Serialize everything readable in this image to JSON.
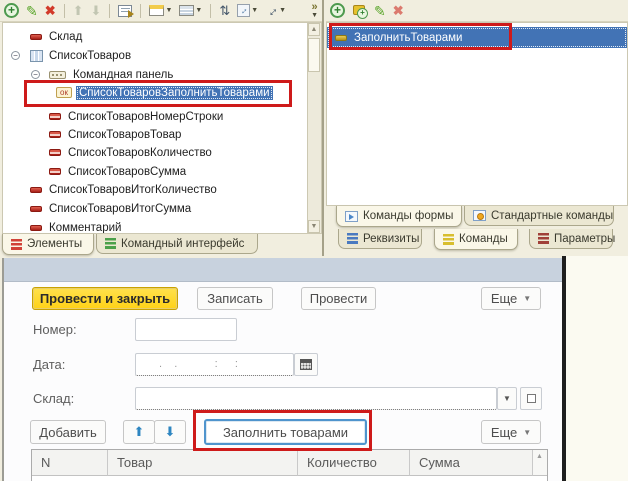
{
  "colors": {
    "annotation_red": "#CE1A1A",
    "selection_blue": "#4273B5",
    "primary_button_yellow": "#FFD216",
    "form_header_strip": "#C8D2DE",
    "designer_background": "#F1EEDF"
  },
  "left_panel": {
    "toolbar": [
      {
        "name": "add-button",
        "icon": "add-icon",
        "glyph": "+"
      },
      {
        "name": "edit-button",
        "icon": "pencil-icon",
        "glyph": "✎"
      },
      {
        "name": "delete-button",
        "icon": "delete-icon",
        "glyph": "✖"
      },
      {
        "sep": true
      },
      {
        "name": "move-up-button",
        "icon": "arrow-up-icon",
        "glyph": "⬆"
      },
      {
        "name": "move-down-button",
        "icon": "arrow-down-icon",
        "glyph": "⬇"
      },
      {
        "sep": true
      },
      {
        "name": "check-form-button",
        "icon": "form-check-icon"
      },
      {
        "sep": true
      },
      {
        "name": "form-view-button",
        "icon": "window-title-icon",
        "dropdown": true
      },
      {
        "name": "form-arrangement-button",
        "icon": "window-rows-icon",
        "dropdown": true
      },
      {
        "sep": true
      },
      {
        "name": "swap-elements-button",
        "icon": "swap-arrows-icon",
        "glyph": "⇅"
      },
      {
        "name": "resize-mode-button",
        "icon": "resize-box-icon",
        "glyph": "↔",
        "dropdown": true
      },
      {
        "name": "spacing-button",
        "icon": "diagonal-arrow-icon",
        "glyph": "↔",
        "dropdown": true
      }
    ],
    "overflow": {
      "name": "toolbar-overflow",
      "glyph": "»"
    },
    "tree": [
      {
        "label": "Склад",
        "depth": 0,
        "icon": "field-icon"
      },
      {
        "label": "СписокТоваров",
        "depth": 0,
        "icon": "table-icon",
        "expanded": true
      },
      {
        "label": "Командная панель",
        "depth": 1,
        "icon": "command-bar-icon",
        "expanded": true
      },
      {
        "label": "СписокТоваровЗаполнитьТоварами",
        "depth": 2,
        "icon": "ok-button-icon",
        "icon_text": "ок",
        "selected": true
      },
      {
        "label": "СписокТоваровНомерСтроки",
        "depth": 1,
        "icon": "column-icon"
      },
      {
        "label": "СписокТоваровТовар",
        "depth": 1,
        "icon": "column-icon"
      },
      {
        "label": "СписокТоваровКоличество",
        "depth": 1,
        "icon": "column-icon"
      },
      {
        "label": "СписокТоваровСумма",
        "depth": 1,
        "icon": "column-icon"
      },
      {
        "label": "СписокТоваровИтогКоличество",
        "depth": 0,
        "icon": "field-icon"
      },
      {
        "label": "СписокТоваровИтогСумма",
        "depth": 0,
        "icon": "field-icon"
      },
      {
        "label": "Комментарий",
        "depth": 0,
        "icon": "field-icon"
      }
    ],
    "tabs": [
      {
        "label": "Элементы",
        "icon_color": "#D14238",
        "active": true
      },
      {
        "label": "Командный интерфейс",
        "icon_color": "#4BA04B",
        "active": false
      }
    ]
  },
  "right_panel": {
    "toolbar": [
      {
        "name": "add-command-button",
        "icon": "add-icon",
        "glyph": "+"
      },
      {
        "name": "add-standard-command-button",
        "icon": "add-standard-icon"
      },
      {
        "name": "edit-command-button",
        "icon": "pencil-icon",
        "glyph": "✎"
      },
      {
        "name": "delete-command-button",
        "icon": "delete-icon",
        "glyph": "✖",
        "dim": true
      }
    ],
    "list": [
      {
        "label": "ЗаполнитьТоварами",
        "icon": "command-icon",
        "selected": true
      }
    ],
    "inner_tabs": [
      {
        "label": "Команды формы",
        "icon": "play",
        "active": true
      },
      {
        "label": "Стандартные команды",
        "icon": "dot",
        "active": false
      }
    ],
    "outer_tabs": [
      {
        "label": "Реквизиты",
        "icon_color": "#4A7AC0",
        "active": false
      },
      {
        "label": "Команды",
        "icon_color": "#D8BE2E",
        "active": true
      },
      {
        "label": "Параметры",
        "icon_color": "#A04038",
        "active": false
      }
    ]
  },
  "form_preview": {
    "commands": [
      {
        "label": "Провести и закрыть"
      },
      {
        "label": "Записать"
      },
      {
        "label": "Провести"
      },
      {
        "label": "Еще"
      }
    ],
    "fields": [
      {
        "label": "Номер:"
      },
      {
        "label": "Дата:",
        "placeholder": " .  .       :   :"
      },
      {
        "label": "Склад:"
      }
    ],
    "table_toolbar": {
      "add_label": "Добавить",
      "fill_label": "Заполнить товарами",
      "more_label": "Еще"
    },
    "table_headers": [
      "N",
      "Товар",
      "Количество",
      "Сумма"
    ]
  }
}
